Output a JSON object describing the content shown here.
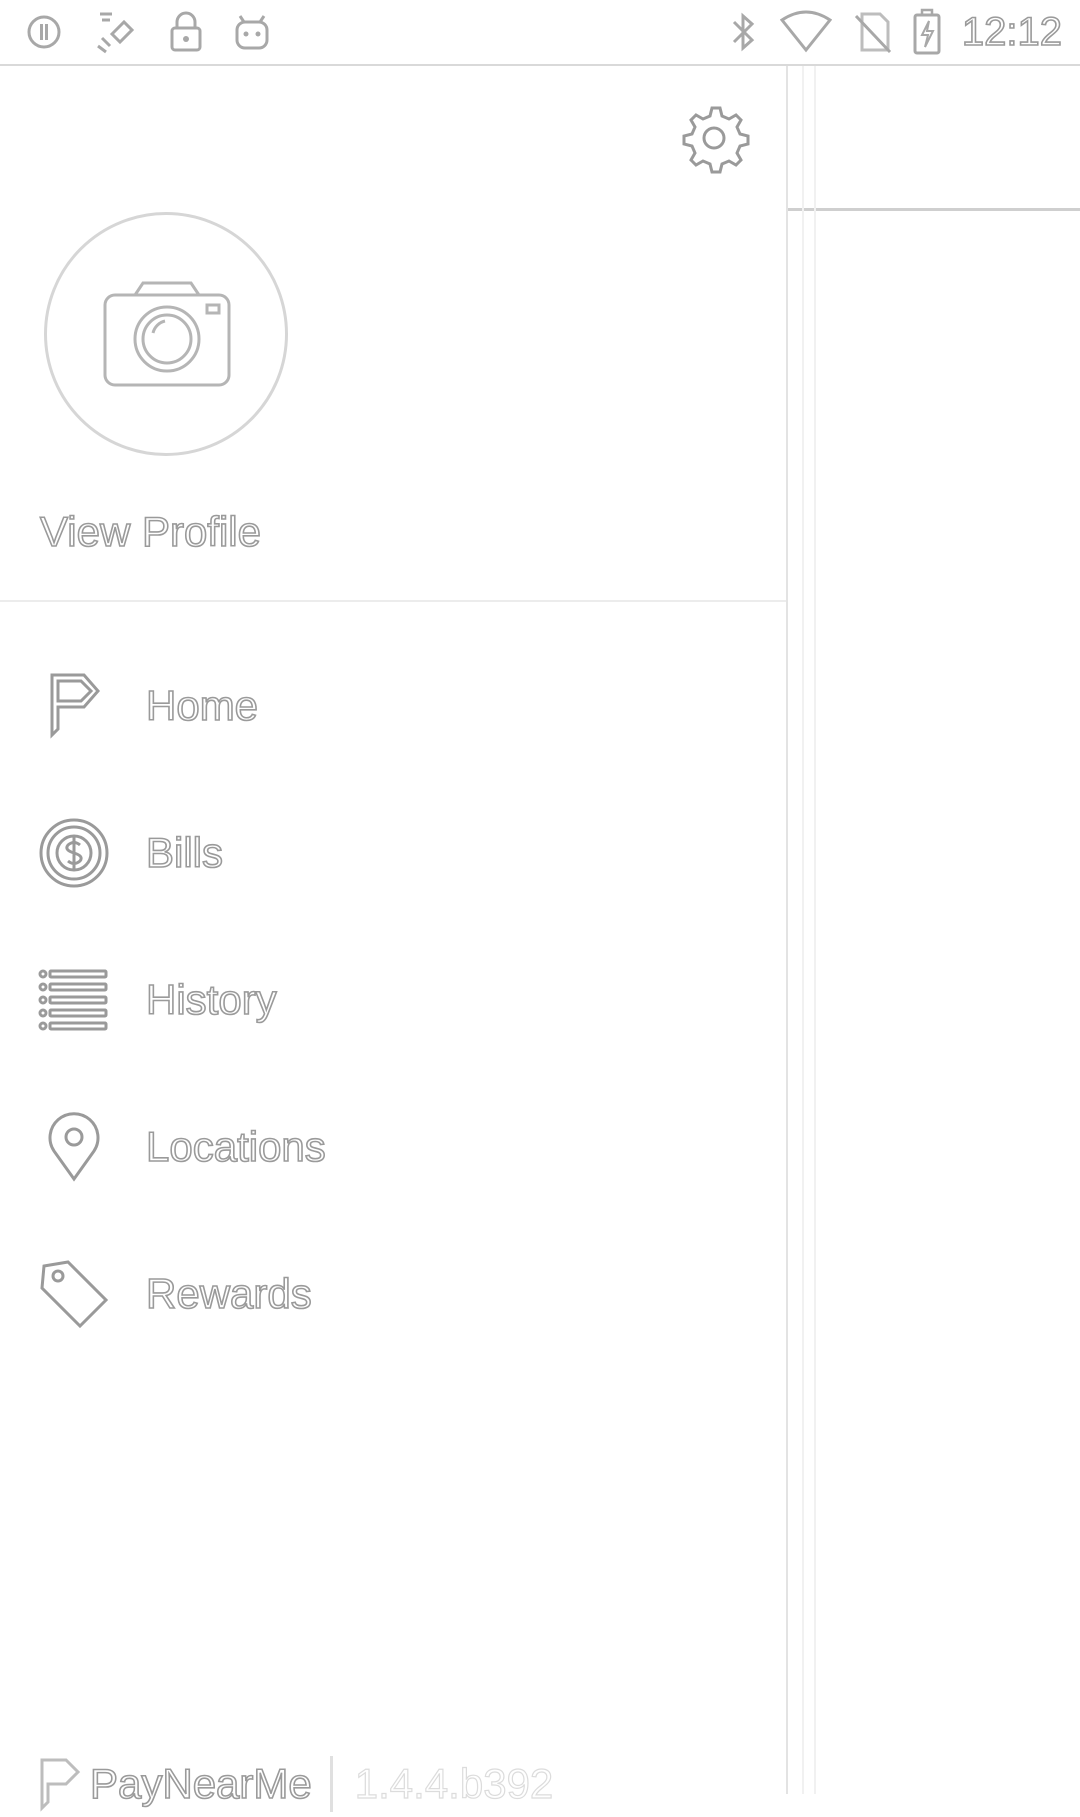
{
  "status_bar": {
    "time": "12:12",
    "left_icons": [
      "sync-icon",
      "satellite-icon",
      "lock-icon",
      "android-icon"
    ],
    "right_icons": [
      "bluetooth-icon",
      "wifi-icon",
      "no-sim-icon",
      "battery-charging-icon"
    ]
  },
  "drawer": {
    "settings_icon": "gear-icon",
    "avatar_icon": "camera-icon",
    "view_profile_label": "View Profile",
    "menu": [
      {
        "label": "Home",
        "icon": "paynearme-flag-icon"
      },
      {
        "label": "Bills",
        "icon": "dollar-coin-icon"
      },
      {
        "label": "History",
        "icon": "list-icon"
      },
      {
        "label": "Locations",
        "icon": "map-pin-icon"
      },
      {
        "label": "Rewards",
        "icon": "tag-icon"
      }
    ],
    "footer": {
      "brand": "PayNearMe",
      "version": "1.4.4.b392"
    }
  },
  "colors": {
    "outline": "#9a9a9a",
    "divider": "#ececec",
    "background": "#ffffff"
  }
}
